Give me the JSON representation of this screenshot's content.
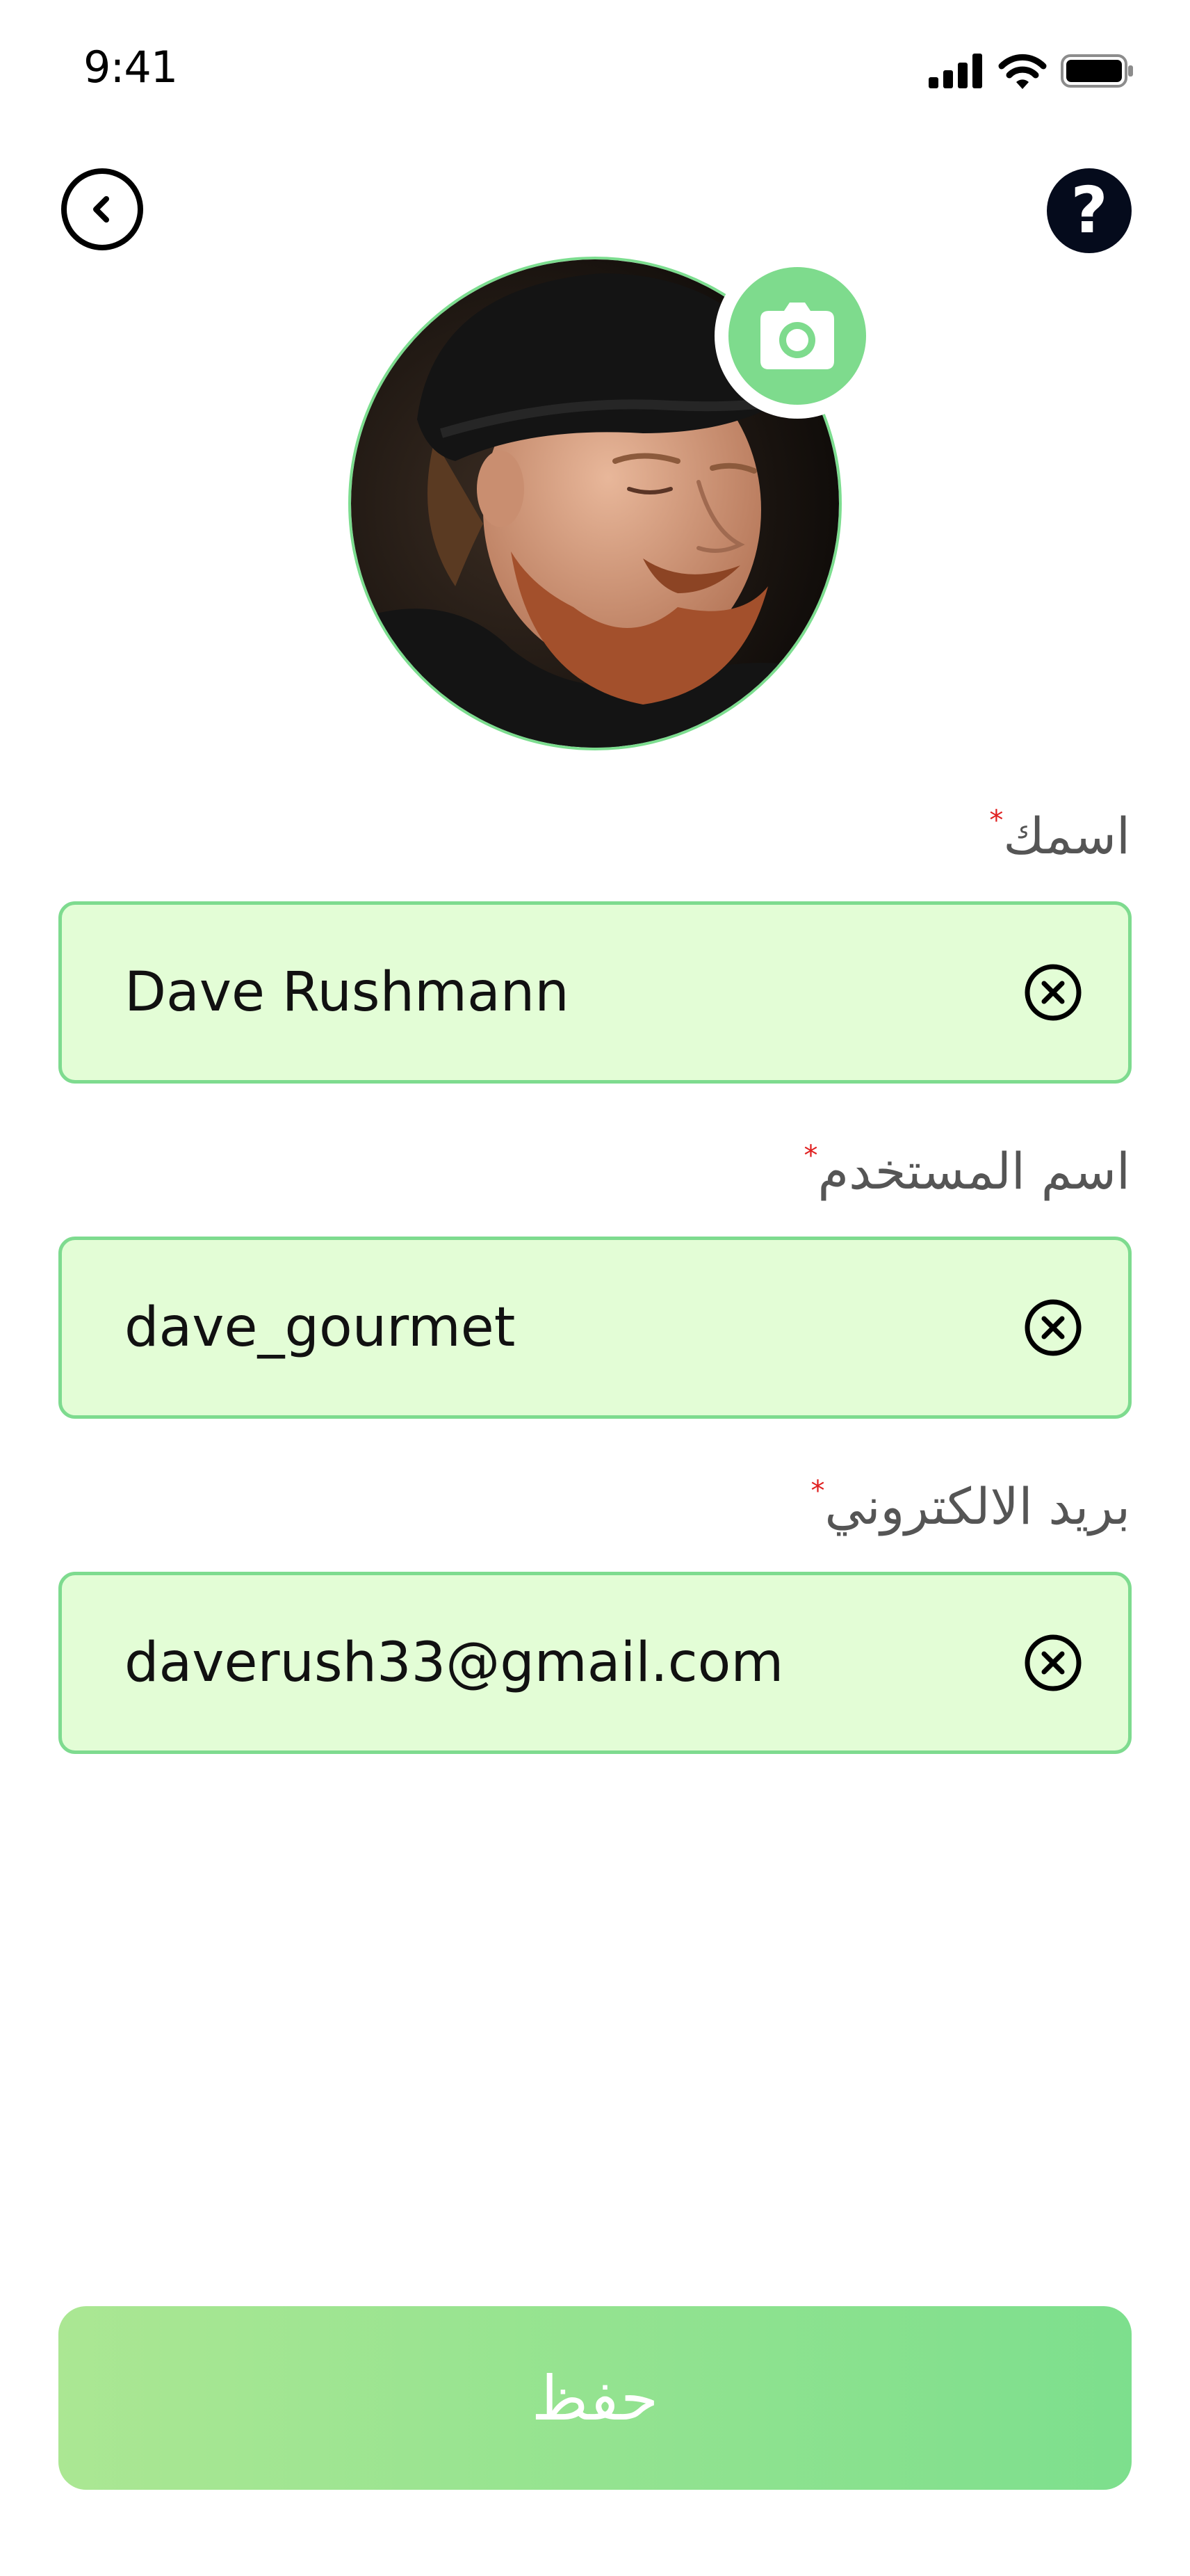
{
  "status_bar": {
    "time": "9:41",
    "icons": [
      "cellular-signal-icon",
      "wifi-icon",
      "battery-icon"
    ]
  },
  "header": {
    "back_icon": "chevron-left-icon",
    "help_icon": "question-mark-icon",
    "help_glyph": "?"
  },
  "profile": {
    "avatar": "profile-photo",
    "camera_icon": "camera-icon"
  },
  "form": {
    "required_mark": "*",
    "name": {
      "label": "اسمك",
      "value": "Dave Rushmann"
    },
    "username": {
      "label": "اسم المستخدم",
      "value": "dave_gourmet"
    },
    "email": {
      "label": "بريد الالكتروني",
      "value": "daverush33@gmail.com"
    },
    "clear_icon": "clear-circle-x-icon"
  },
  "actions": {
    "save_label": "حفظ"
  },
  "colors": {
    "accent": "#7edb8f",
    "field_background": "#e3fdd6",
    "required": "#e02020",
    "help_background": "#050b1c",
    "save_gradient_start": "#abe793",
    "save_gradient_end": "#7ddf8d"
  }
}
